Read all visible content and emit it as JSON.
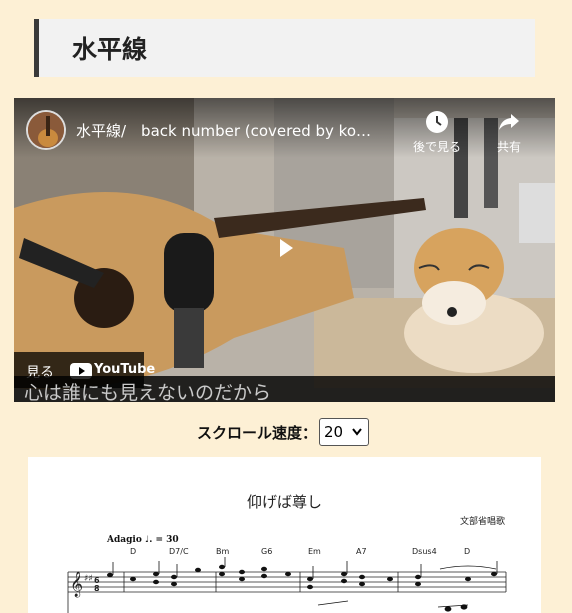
{
  "page": {
    "title": "水平線"
  },
  "video": {
    "title": "水平線/　back number (covered by ko…",
    "watch_later": "後で見る",
    "share": "共有",
    "watch_on": "見る",
    "youtube": "YouTube",
    "lyric": "心は誰にも見えないのだから"
  },
  "scroll": {
    "label": "スクロール速度：",
    "value": "20"
  },
  "sheet": {
    "title": "仰げば尊し",
    "author": "文部省唱歌",
    "tempo": "Adagio ♩. = 30",
    "chords": [
      "D",
      "D7/C",
      "Bm",
      "G6",
      "Em",
      "A7",
      "Dsus4",
      "D"
    ]
  },
  "colors": {
    "background": "#fdf0d5",
    "title_box": "#f2f2f2",
    "title_border": "#3a3a3a"
  }
}
